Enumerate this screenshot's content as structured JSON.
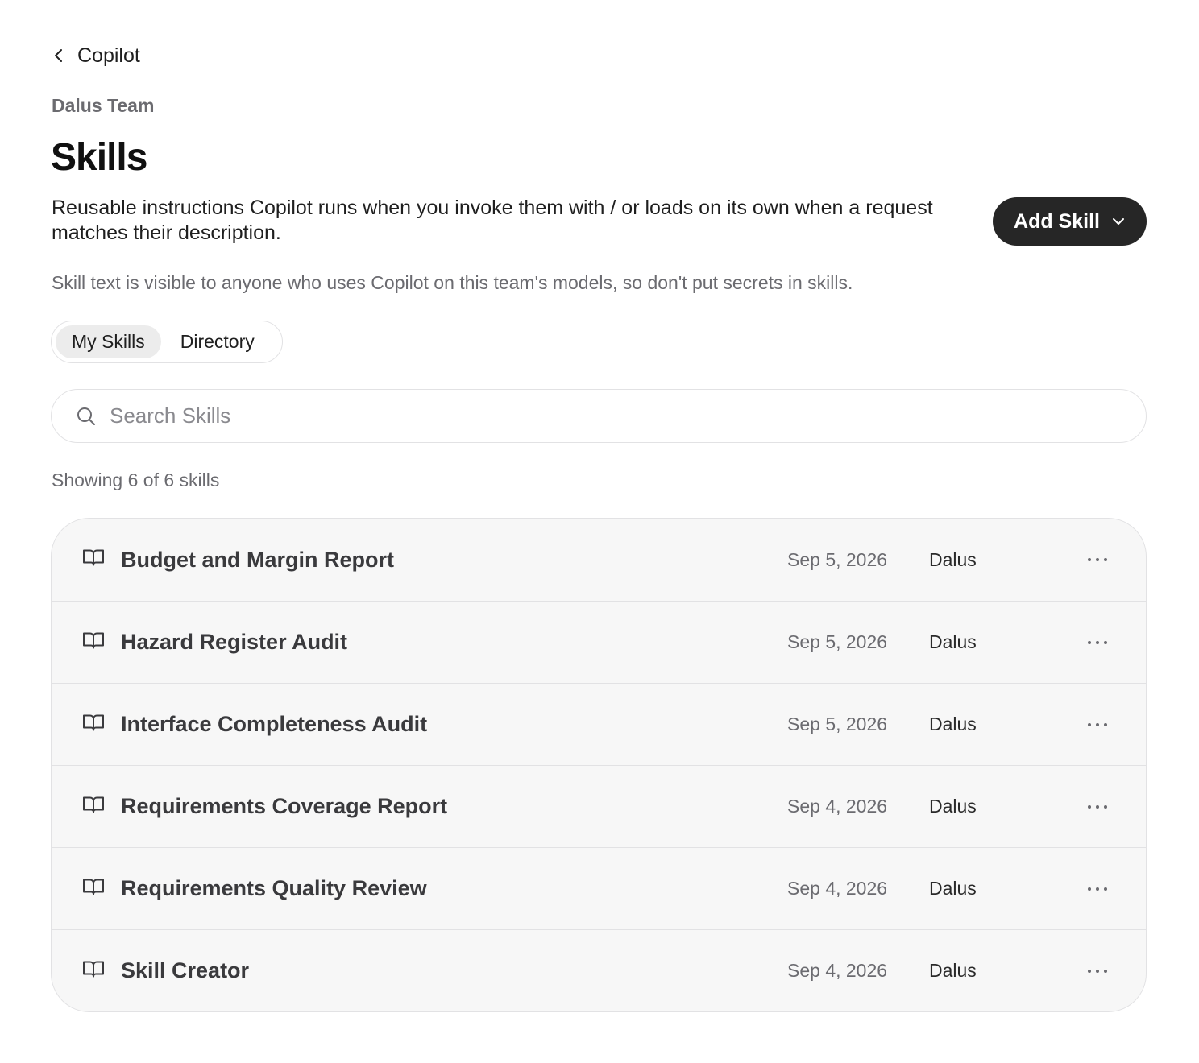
{
  "nav": {
    "back_label": "Copilot"
  },
  "header": {
    "team_name": "Dalus Team",
    "title": "Skills",
    "description": "Reusable instructions Copilot runs when you invoke them with / or loads on its own when a request matches their description.",
    "add_button_label": "Add Skill",
    "warning": "Skill text is visible to anyone who uses Copilot on this team's models, so don't put secrets in skills."
  },
  "tabs": [
    {
      "label": "My Skills",
      "active": true
    },
    {
      "label": "Directory",
      "active": false
    }
  ],
  "search": {
    "placeholder": "Search Skills",
    "value": ""
  },
  "result_count": "Showing 6 of 6 skills",
  "skills": [
    {
      "name": "Budget and Margin Report",
      "date": "Sep 5, 2026",
      "owner": "Dalus"
    },
    {
      "name": "Hazard Register Audit",
      "date": "Sep 5, 2026",
      "owner": "Dalus"
    },
    {
      "name": "Interface Completeness Audit",
      "date": "Sep 5, 2026",
      "owner": "Dalus"
    },
    {
      "name": "Requirements Coverage Report",
      "date": "Sep 4, 2026",
      "owner": "Dalus"
    },
    {
      "name": "Requirements Quality Review",
      "date": "Sep 4, 2026",
      "owner": "Dalus"
    },
    {
      "name": "Skill Creator",
      "date": "Sep 4, 2026",
      "owner": "Dalus"
    }
  ],
  "icons": {
    "back": "chevron-left-icon",
    "add_dropdown": "chevron-down-icon",
    "search": "search-icon",
    "skill": "book-open-icon",
    "more": "more-horizontal-icon"
  },
  "colors": {
    "primary_button": "#262626",
    "list_background": "#f7f7f7",
    "border": "#e2e2e4",
    "muted_text": "#6b6b70"
  }
}
